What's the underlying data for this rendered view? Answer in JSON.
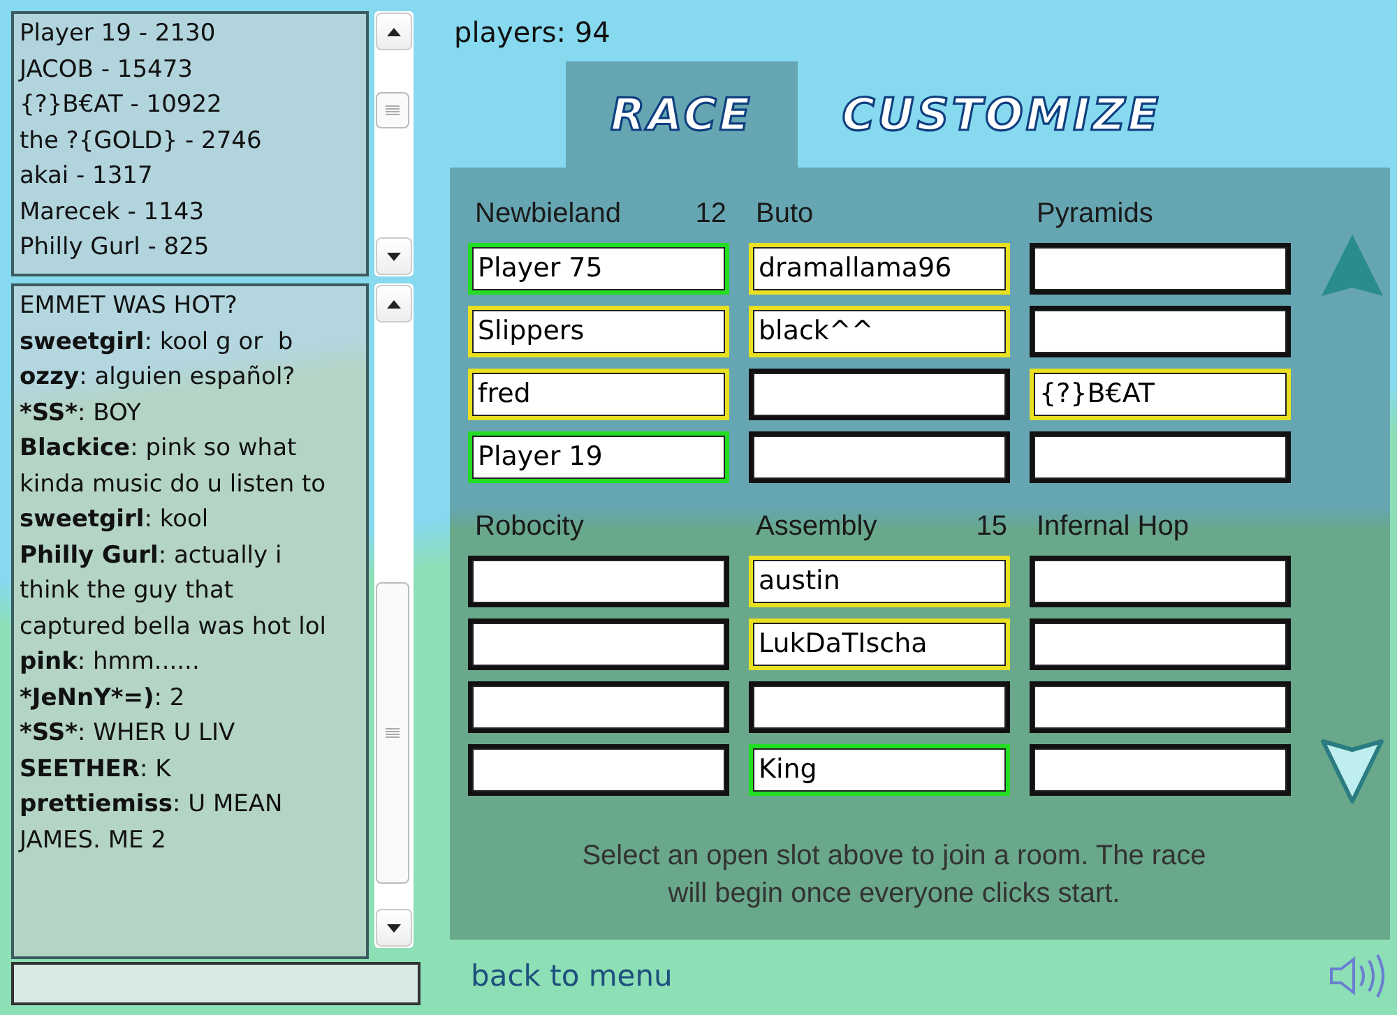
{
  "leaderboard": [
    "Player 19 - 2130",
    "JACOB - 15473",
    "{?}B€AT - 10922",
    "the ?{GOLD} - 2746",
    "akai - 1317",
    "Marecek - 1143",
    "Philly Gurl - 825"
  ],
  "chat": {
    "messages": [
      {
        "text": "EMMET WAS HOT?"
      },
      {
        "user": "sweetgirl",
        "text": ": kool g or  b"
      },
      {
        "user": "ozzy",
        "text": ": alguien español?"
      },
      {
        "user": "*SS*",
        "text": ": BOY"
      },
      {
        "user": "Blackice",
        "text": ": pink so what kinda music do u listen to"
      },
      {
        "user": "sweetgirl",
        "text": ": kool"
      },
      {
        "user": "Philly Gurl",
        "text": ": actually i think the guy that captured bella was hot lol"
      },
      {
        "user": "pink",
        "text": ": hmm......"
      },
      {
        "user": "*JeNnY*=)",
        "text": ": 2"
      },
      {
        "user": "*SS*",
        "text": ": WHER U LIV"
      },
      {
        "user": "SEETHER",
        "text": ": K"
      },
      {
        "user": "prettiemiss",
        "text": ": U MEAN JAMES. ME 2"
      }
    ]
  },
  "players_count": "players: 94",
  "tabs": [
    {
      "label": "RACE",
      "selected": true
    },
    {
      "label": "CUSTOMIZE",
      "selected": false
    }
  ],
  "rooms": [
    {
      "name": "Newbieland",
      "count": "12",
      "slots": [
        {
          "player": "Player 75",
          "color": "#22dd22"
        },
        {
          "player": "Slippers",
          "color": "#e8e020"
        },
        {
          "player": "fred",
          "color": "#e8e020"
        },
        {
          "player": "Player 19",
          "color": "#22dd22"
        }
      ]
    },
    {
      "name": "Buto",
      "slots": [
        {
          "player": "dramallama96",
          "color": "#e8e020"
        },
        {
          "player": "black^^",
          "color": "#e8e020"
        },
        {
          "color": "#111111"
        },
        {
          "color": "#111111"
        }
      ]
    },
    {
      "name": "Pyramids",
      "slots": [
        {
          "color": "#111111"
        },
        {
          "color": "#111111"
        },
        {
          "player": "{?}B€AT",
          "color": "#e8e020"
        },
        {
          "color": "#111111"
        }
      ]
    },
    {
      "name": "Robocity",
      "slots": [
        {
          "color": "#111111"
        },
        {
          "color": "#111111"
        },
        {
          "color": "#111111"
        },
        {
          "color": "#111111"
        }
      ]
    },
    {
      "name": "Assembly",
      "count": "15",
      "slots": [
        {
          "player": "austin",
          "color": "#e8e020"
        },
        {
          "player": "LukDaTIscha",
          "color": "#e8e020"
        },
        {
          "color": "#111111"
        },
        {
          "player": "King",
          "color": "#22dd22"
        }
      ]
    },
    {
      "name": "Infernal Hop",
      "slots": [
        {
          "color": "#111111"
        },
        {
          "color": "#111111"
        },
        {
          "color": "#111111"
        },
        {
          "color": "#111111"
        }
      ]
    }
  ],
  "instructions": "Select an open slot above to join a room. The race will begin once everyone clicks start.",
  "back_link": "back to menu"
}
